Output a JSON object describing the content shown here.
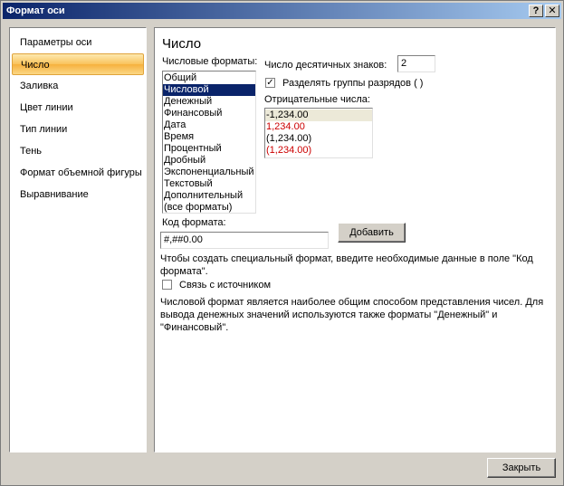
{
  "window": {
    "title": "Формат оси",
    "help_label": "?",
    "close_label": "✕"
  },
  "nav": {
    "items": [
      {
        "label": "Параметры оси"
      },
      {
        "label": "Число"
      },
      {
        "label": "Заливка"
      },
      {
        "label": "Цвет линии"
      },
      {
        "label": "Тип линии"
      },
      {
        "label": "Тень"
      },
      {
        "label": "Формат объемной фигуры"
      },
      {
        "label": "Выравнивание"
      }
    ],
    "selected_index": 1
  },
  "panel": {
    "title": "Число",
    "formats_label": "Числовые форматы:",
    "formats": [
      "Общий",
      "Числовой",
      "Денежный",
      "Финансовый",
      "Дата",
      "Время",
      "Процентный",
      "Дробный",
      "Экспоненциальный",
      "Текстовый",
      "Дополнительный",
      "(все форматы)"
    ],
    "selected_format_index": 1,
    "decimals_label": "Число десятичных знаков:",
    "decimals_value": "2",
    "separator_label": "Разделять группы разрядов ( )",
    "separator_checked": "✓",
    "negative_label": "Отрицательные числа:",
    "negative_numbers": [
      {
        "text": "-1,234.00",
        "color": "#000000"
      },
      {
        "text": "1,234.00",
        "color": "#cc0000"
      },
      {
        "text": "(1,234.00)",
        "color": "#000000"
      },
      {
        "text": "(1,234.00)",
        "color": "#cc0000"
      }
    ],
    "code_label": "Код формата:",
    "code_value": "#,##0.00",
    "add_button": "Добавить",
    "hint": "Чтобы создать специальный формат, введите необходимые данные в поле \"Код формата\".",
    "link_label": "Связь с источником",
    "description": "Числовой формат является наиболее общим способом представления чисел. Для вывода денежных значений используются также форматы \"Денежный\" и \"Финансовый\"."
  },
  "footer": {
    "close_button": "Закрыть"
  }
}
